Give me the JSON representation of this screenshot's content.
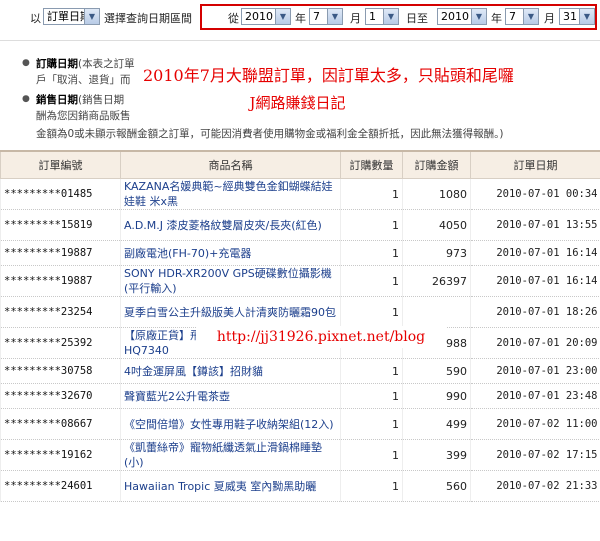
{
  "filter": {
    "prefix": "以",
    "type_select": "訂單日期",
    "range_label": "選擇查詢日期區間",
    "from_label": "從",
    "from_year": "2010",
    "year_unit_1": "年",
    "from_month": "7",
    "month_unit_1": "月",
    "from_day": "1",
    "to_label": "日至",
    "to_year": "2010",
    "year_unit_2": "年",
    "to_month": "7",
    "month_unit_2": "月",
    "to_day": "31"
  },
  "notes": {
    "line1_bold": "訂購日期",
    "line1_text": "(本表之訂單",
    "line2_text": "戶「取消、退貨」而",
    "line3_bold": "銷售日期",
    "line3_text": "(銷售日期",
    "line4_text": "酬為您因銷商品販售",
    "line5_text": "金額為0或未顯示報酬金額之訂單，可能因消費者使用購物金或福利金全額折抵，因此無法獲得報酬。)"
  },
  "overlay": {
    "headline": "2010年7月大聯盟訂單，因訂單太多，只貼頭和尾囉",
    "blog_name": "J網路賺錢日記",
    "url": "http://jj31926.pixnet.net/blog"
  },
  "table": {
    "headers": [
      "訂單編號",
      "商品名稱",
      "訂購數量",
      "訂購金額",
      "訂單日期"
    ],
    "rows": [
      {
        "id": "*********01485",
        "name": "KAZANA名媛典範~經典雙色金釦蝴蝶結娃娃鞋 米x黑",
        "qty": "1",
        "amount": "1080",
        "date": "2010-07-01 00:34"
      },
      {
        "id": "*********15819",
        "name": "A.D.M.J 漆皮菱格紋雙層皮夾/長夾(紅色)",
        "qty": "1",
        "amount": "4050",
        "date": "2010-07-01 13:55"
      },
      {
        "id": "*********19887",
        "name": "副廠電池(FH-70)+充電器",
        "qty": "1",
        "amount": "973",
        "date": "2010-07-01 16:14"
      },
      {
        "id": "*********19887",
        "name": "SONY HDR-XR200V GPS硬碟數位攝影機(平行輸入)",
        "qty": "1",
        "amount": "26397",
        "date": "2010-07-01 16:14"
      },
      {
        "id": "*********23254",
        "name": "夏季白雪公主升級版美人計清爽防曬霜90包",
        "qty": "1",
        "amount": "",
        "date": "2010-07-01 18:26"
      },
      {
        "id": "*********25392",
        "name": "【原廠正貨】飛利浦3D立體三刀頭電鬍刀HQ7340",
        "qty": "1",
        "amount": "2988",
        "date": "2010-07-01 20:09"
      },
      {
        "id": "*********30758",
        "name": "4吋金運屏風【鐏該】招財貓",
        "qty": "1",
        "amount": "590",
        "date": "2010-07-01 23:00"
      },
      {
        "id": "*********32670",
        "name": "聲寶藍光2公升電茶壺",
        "qty": "1",
        "amount": "990",
        "date": "2010-07-01 23:48"
      },
      {
        "id": "*********08667",
        "name": "《空間倍增》女性專用鞋子收納架組(12入)",
        "qty": "1",
        "amount": "499",
        "date": "2010-07-02 11:00"
      },
      {
        "id": "*********19162",
        "name": "《凱蕾絲帝》寵物紙纖透氣止滑鍋棉睡墊(小)",
        "qty": "1",
        "amount": "399",
        "date": "2010-07-02 17:15"
      },
      {
        "id": "*********24601",
        "name": "Hawaiian Tropic 夏威夷 室內黝黑助曬",
        "qty": "1",
        "amount": "560",
        "date": "2010-07-02 21:33"
      }
    ]
  }
}
